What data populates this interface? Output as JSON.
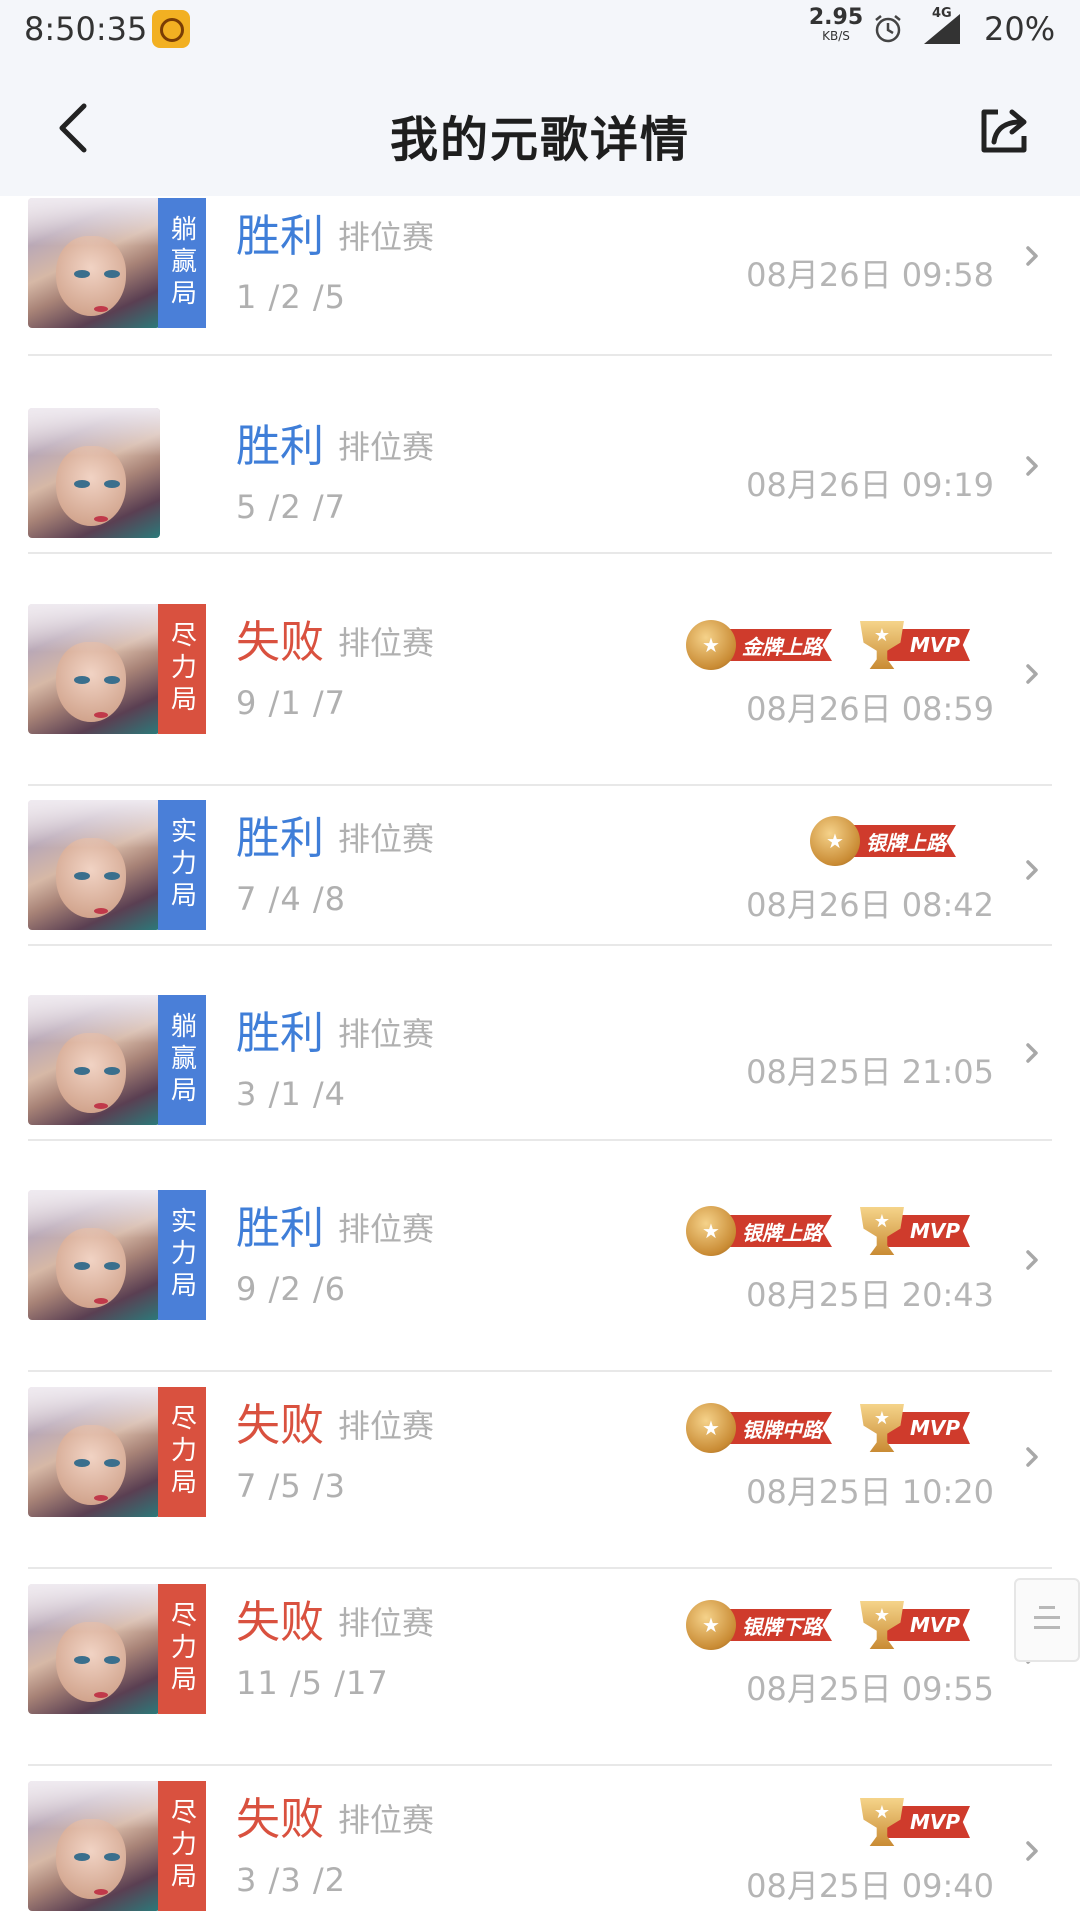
{
  "status_bar": {
    "time": "8:50:35",
    "speed_value": "2.95",
    "speed_unit": "KB/S",
    "network": "4G",
    "battery": "20%"
  },
  "header": {
    "title": "我的元歌详情",
    "back_icon": "chevron-left-icon",
    "share_icon": "share-icon"
  },
  "colors": {
    "win": "#3f7ed8",
    "lose": "#d9513f",
    "tag_blue": "#4a7fd8",
    "tag_red": "#d9513f"
  },
  "matches": [
    {
      "tag": "躺赢局",
      "tag_color": "blue",
      "result": "胜利",
      "outcome": "win",
      "mode": "排位赛",
      "kda": "1 /2 /5",
      "date": "08月26日 09:58",
      "badges": []
    },
    {
      "tag": "",
      "tag_color": "",
      "result": "胜利",
      "outcome": "win",
      "mode": "排位赛",
      "kda": "5 /2 /7",
      "date": "08月26日 09:19",
      "badges": []
    },
    {
      "tag": "尽力局",
      "tag_color": "red",
      "result": "失败",
      "outcome": "lose",
      "mode": "排位赛",
      "kda": "9 /1 /7",
      "date": "08月26日 08:59",
      "badges": [
        {
          "kind": "medal",
          "text": "金牌上路"
        },
        {
          "kind": "mvp",
          "text": "MVP"
        }
      ]
    },
    {
      "tag": "实力局",
      "tag_color": "blue",
      "result": "胜利",
      "outcome": "win",
      "mode": "排位赛",
      "kda": "7 /4 /8",
      "date": "08月26日 08:42",
      "badges": [
        {
          "kind": "medal",
          "text": "银牌上路"
        }
      ]
    },
    {
      "tag": "躺赢局",
      "tag_color": "blue",
      "result": "胜利",
      "outcome": "win",
      "mode": "排位赛",
      "kda": "3 /1 /4",
      "date": "08月25日 21:05",
      "badges": []
    },
    {
      "tag": "实力局",
      "tag_color": "blue",
      "result": "胜利",
      "outcome": "win",
      "mode": "排位赛",
      "kda": "9 /2 /6",
      "date": "08月25日 20:43",
      "badges": [
        {
          "kind": "medal",
          "text": "银牌上路"
        },
        {
          "kind": "mvp",
          "text": "MVP"
        }
      ]
    },
    {
      "tag": "尽力局",
      "tag_color": "red",
      "result": "失败",
      "outcome": "lose",
      "mode": "排位赛",
      "kda": "7 /5 /3",
      "date": "08月25日 10:20",
      "badges": [
        {
          "kind": "medal",
          "text": "银牌中路"
        },
        {
          "kind": "mvp",
          "text": "MVP"
        }
      ]
    },
    {
      "tag": "尽力局",
      "tag_color": "red",
      "result": "失败",
      "outcome": "lose",
      "mode": "排位赛",
      "kda": "11 /5 /17",
      "date": "08月25日 09:55",
      "badges": [
        {
          "kind": "medal",
          "text": "银牌下路"
        },
        {
          "kind": "mvp",
          "text": "MVP"
        }
      ]
    },
    {
      "tag": "尽力局",
      "tag_color": "red",
      "result": "失败",
      "outcome": "lose",
      "mode": "排位赛",
      "kda": "3 /3 /2",
      "date": "08月25日 09:40",
      "badges": [
        {
          "kind": "mvp",
          "text": "MVP"
        }
      ]
    }
  ]
}
